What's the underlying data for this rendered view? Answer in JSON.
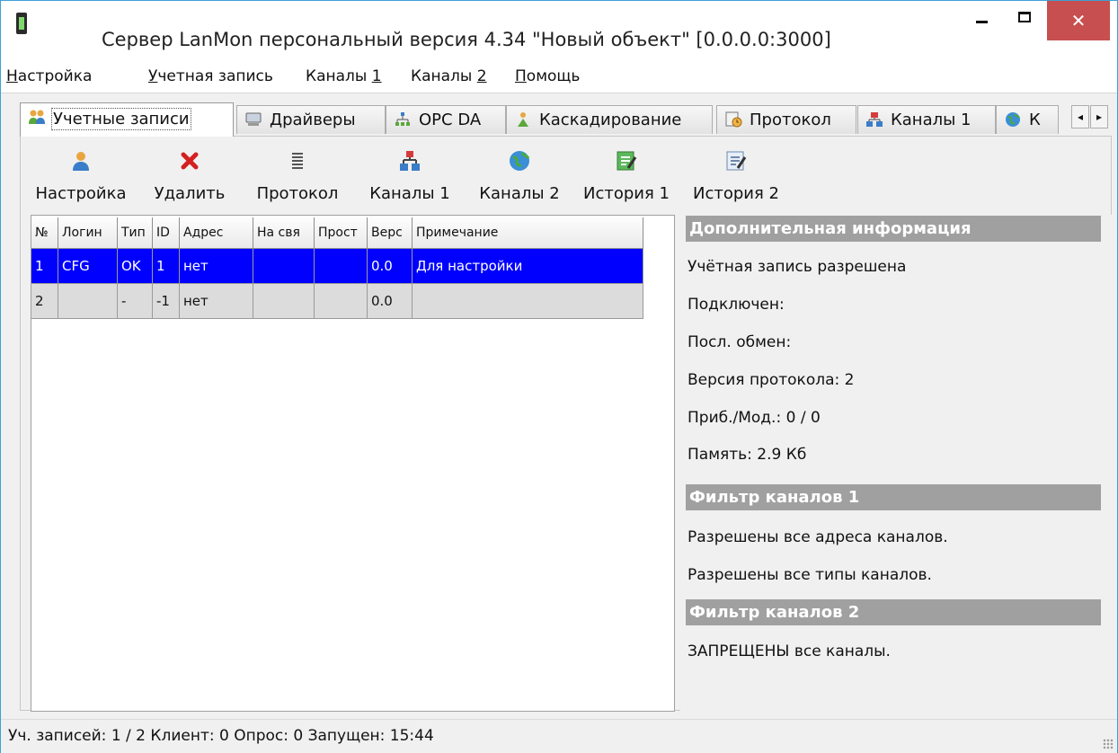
{
  "window": {
    "title": "Сервер LanMon персональный версия 4.34 \"Новый объект\" [0.0.0.0:3000]",
    "close_glyph": "✕",
    "icon": "app-icon"
  },
  "menu": {
    "items": [
      {
        "label_u": "Н",
        "label_rest": "астройка"
      },
      {
        "label_u": "У",
        "label_rest": "четная запись"
      },
      {
        "label_pre": "Каналы ",
        "label_u": "1"
      },
      {
        "label_pre": "Каналы ",
        "label_u": "2"
      },
      {
        "label_u": "П",
        "label_rest": "омощь"
      }
    ]
  },
  "tabs": [
    {
      "label": "Учетные записи",
      "icon": "users-icon",
      "active": true
    },
    {
      "label": "Драйверы",
      "icon": "monitor-icon"
    },
    {
      "label": "OPC DA",
      "icon": "network-icon"
    },
    {
      "label": "Каскадирование",
      "icon": "cascade-icon"
    },
    {
      "label": "Протокол",
      "icon": "clock-doc-icon"
    },
    {
      "label": "Каналы 1",
      "icon": "channels-icon"
    },
    {
      "label": "К",
      "icon": "globe-icon"
    }
  ],
  "tab_scroll": {
    "left": "◂",
    "right": "▸"
  },
  "toolbar": [
    {
      "label": "Настройка",
      "icon": "user-settings-icon"
    },
    {
      "label": "Удалить",
      "icon": "delete-x-icon"
    },
    {
      "label": "Протокол",
      "icon": "list-icon"
    },
    {
      "label": "Каналы 1",
      "icon": "channels-icon"
    },
    {
      "label": "Каналы 2",
      "icon": "globe-icon"
    },
    {
      "label": "История 1",
      "icon": "edit-green-icon"
    },
    {
      "label": "История 2",
      "icon": "edit-icon"
    }
  ],
  "grid": {
    "columns": [
      "№",
      "Логин",
      "Тип",
      "ID",
      "Адрес",
      "На свя",
      "Прост",
      "Верс",
      "Примечание"
    ],
    "rows": [
      {
        "selected": true,
        "cells": [
          "1",
          "CFG",
          "OK",
          "1",
          "нет",
          "",
          "",
          "0.0",
          "Для настройки"
        ]
      },
      {
        "selected": false,
        "cells": [
          "2",
          "",
          "-",
          "-1",
          "нет",
          "",
          "",
          "0.0",
          ""
        ]
      }
    ]
  },
  "info": {
    "section1_title": "Дополнительная информация",
    "lines1": [
      "Учётная запись разрешена",
      "Подключен:",
      "Посл. обмен:",
      "Версия протокола: 2",
      "Приб./Мод.: 0 / 0",
      "Память: 2.9 Кб"
    ],
    "section2_title": "Фильтр каналов 1",
    "lines2": [
      "Разрешены все адреса каналов.",
      "Разрешены все типы каналов."
    ],
    "section3_title": "Фильтр каналов 2",
    "lines3": [
      "ЗАПРЕЩЕНЫ все каналы."
    ]
  },
  "status": {
    "text": "Уч. записей: 1 / 2  Клиент: 0  Опрос: 0  Запущен: 15:44"
  }
}
